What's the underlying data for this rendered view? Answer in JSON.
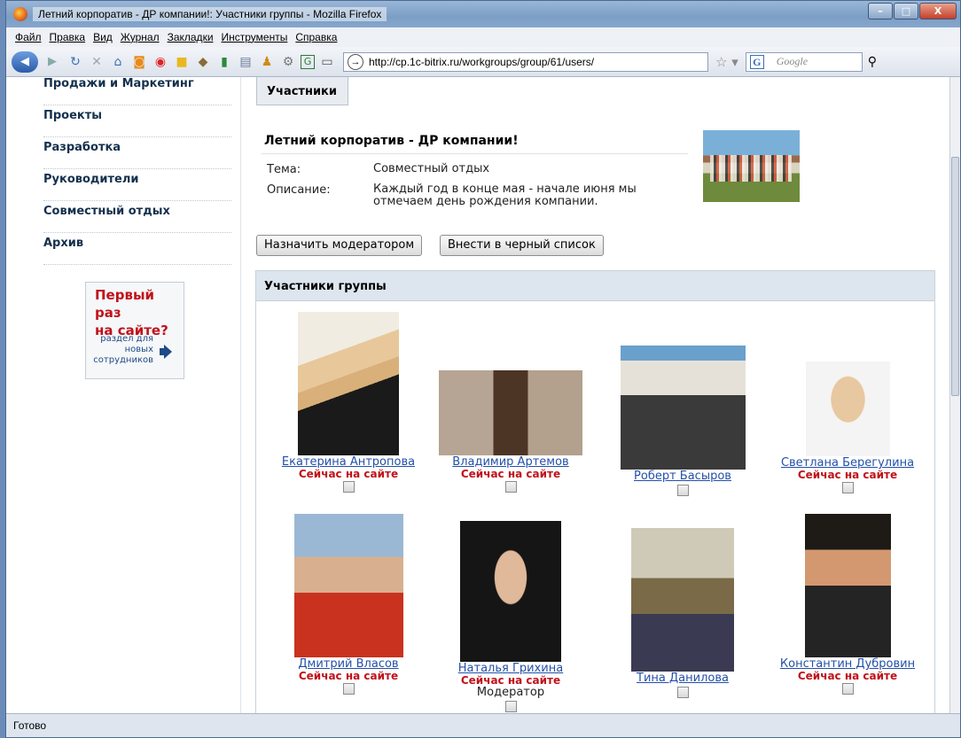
{
  "window": {
    "title": "Летний корпоратив - ДР компании!: Участники группы - Mozilla Firefox",
    "controls": [
      "–",
      "□",
      "X"
    ]
  },
  "menu": [
    "Файл",
    "Правка",
    "Вид",
    "Журнал",
    "Закладки",
    "Инструменты",
    "Справка"
  ],
  "toolbar": {
    "url": "http://cp.1c-bitrix.ru/workgroups/group/61/users/",
    "search_placeholder": "Google"
  },
  "sidebar": {
    "items": [
      "Продажи и Маркетинг",
      "Проекты",
      "Разработка",
      "Руководители",
      "Совместный отдых",
      "Архив"
    ],
    "promo": {
      "title_line1": "Первый раз",
      "title_line2": "на сайте?",
      "sub": "раздел для новых сотрудников"
    }
  },
  "main": {
    "tab": "Участники",
    "group_title": "Летний корпоратив - ДР компании!",
    "topic_label": "Тема:",
    "topic_value": "Совместный отдых",
    "desc_label": "Описание:",
    "desc_value": "Каждый год в конце мая - начале июня мы отмечаем день рождения компании.",
    "buttons": {
      "moderator": "Назначить модератором",
      "blacklist": "Внести в черный список"
    },
    "members_header": "Участники группы",
    "members": [
      {
        "name": "Екатерина Антропова",
        "status": "Сейчас на сайте",
        "role": ""
      },
      {
        "name": "Владимир Артемов",
        "status": "Сейчас на сайте",
        "role": ""
      },
      {
        "name": "Роберт Басыров",
        "status": "",
        "role": ""
      },
      {
        "name": "Светлана Берегулина",
        "status": "Сейчас на сайте",
        "role": ""
      },
      {
        "name": "Дмитрий Власов",
        "status": "Сейчас на сайте",
        "role": ""
      },
      {
        "name": "Наталья Грихина",
        "status": "Сейчас на сайте",
        "role": "Модератор"
      },
      {
        "name": "Тина Данилова",
        "status": "",
        "role": ""
      },
      {
        "name": "Константин Дубровин",
        "status": "Сейчас на сайте",
        "role": ""
      }
    ]
  },
  "statusbar": "Готово"
}
